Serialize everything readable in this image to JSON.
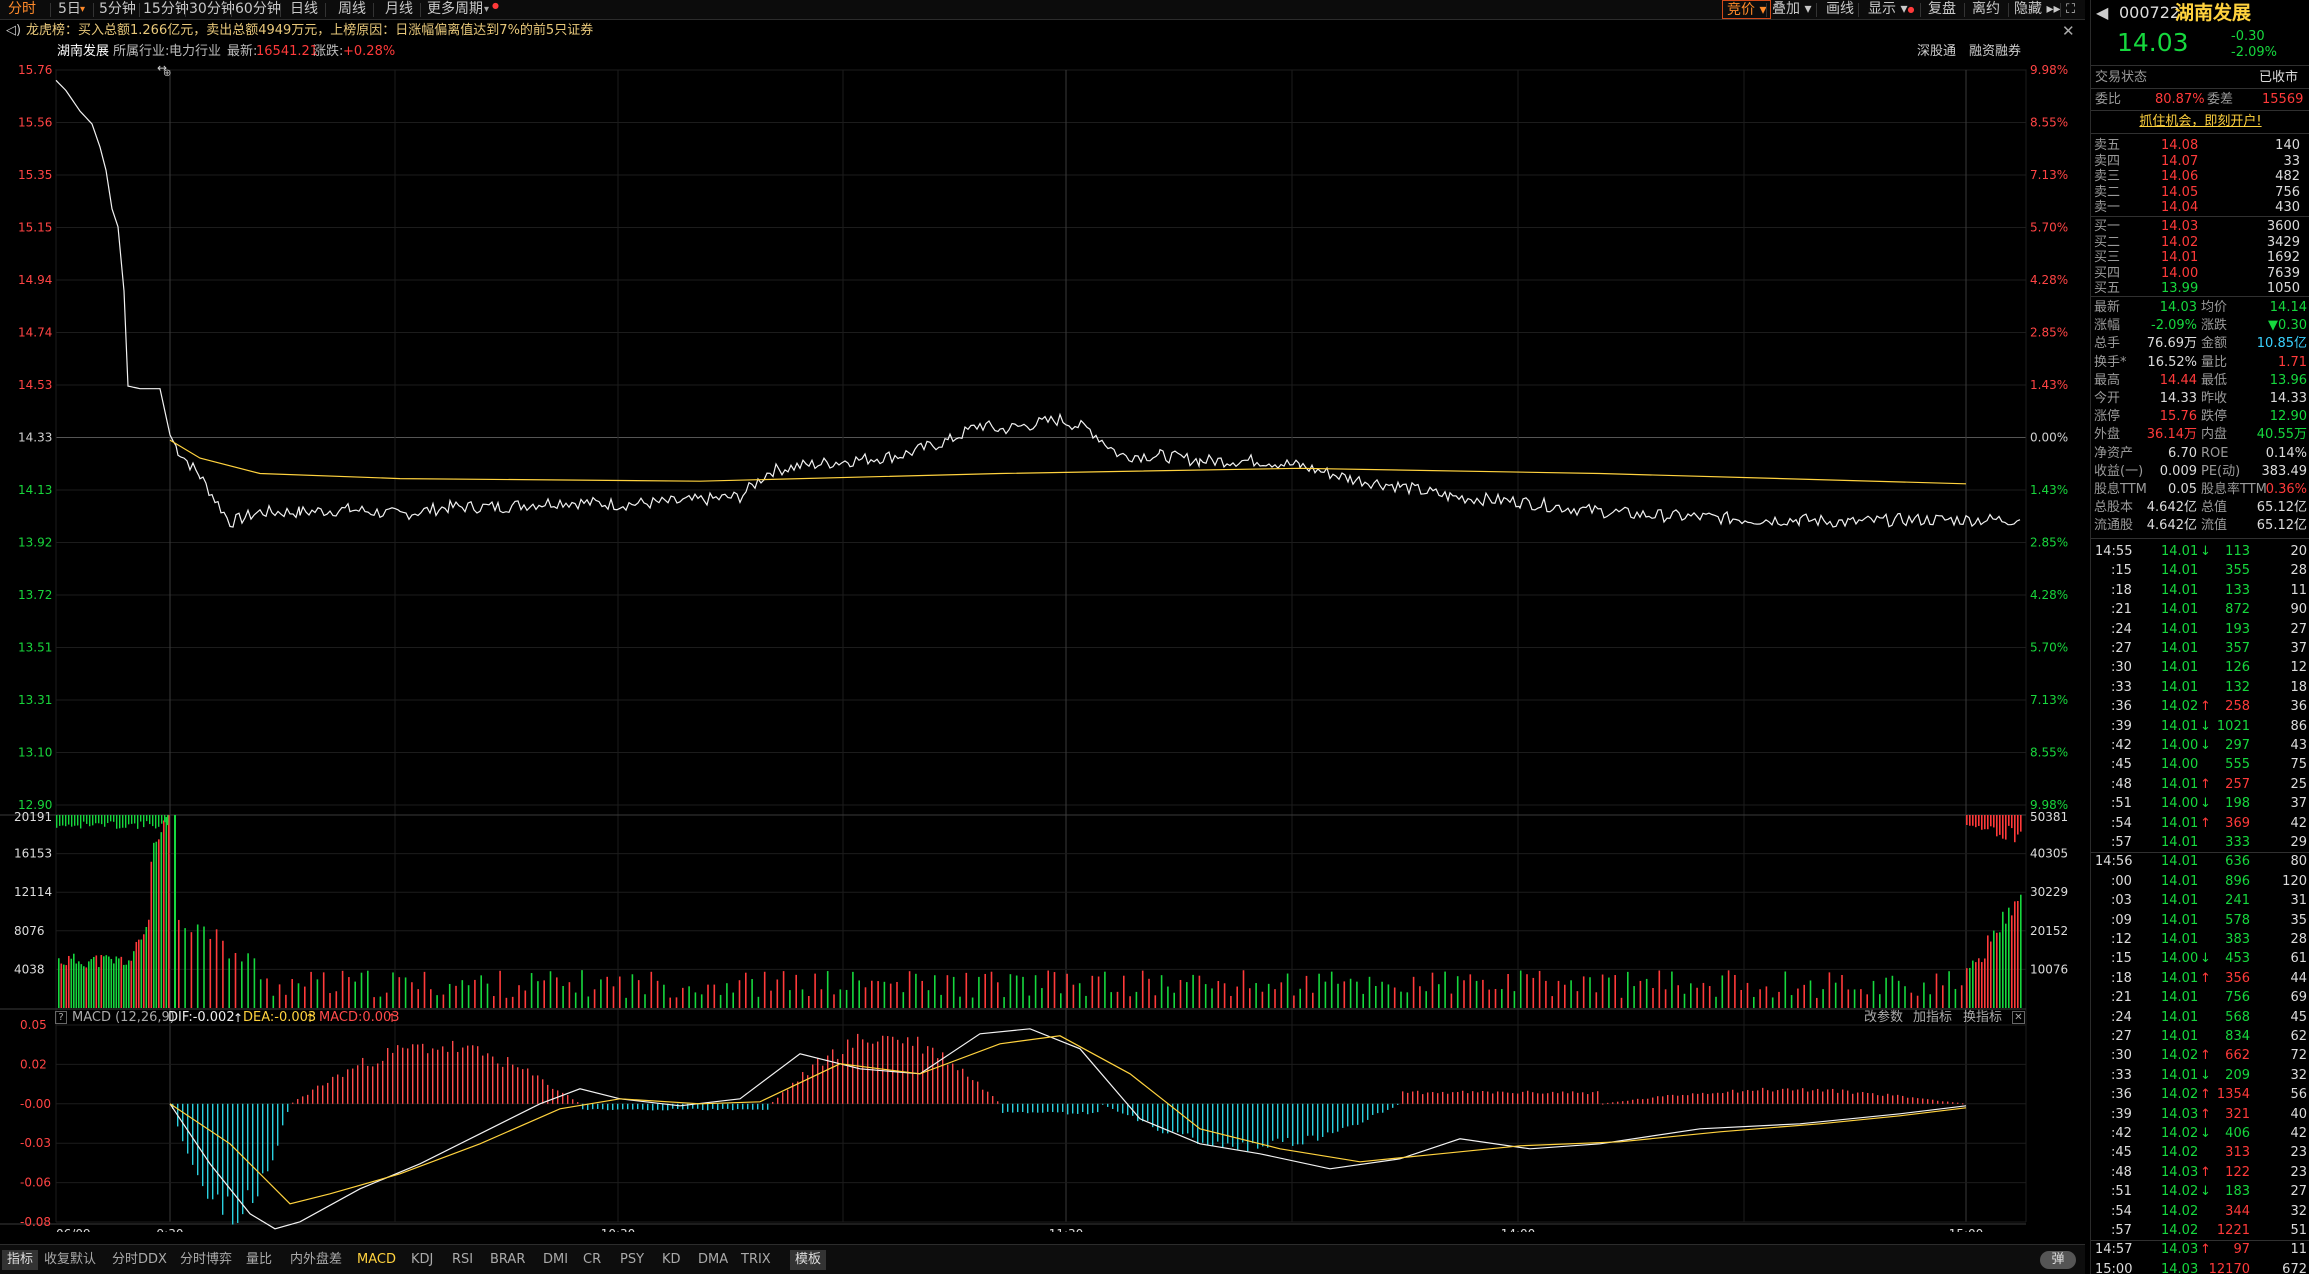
{
  "toolbar": {
    "tabs": [
      "分时",
      "5日",
      "5分钟",
      "15分钟",
      "30分钟",
      "60分钟",
      "日线",
      "周线",
      "月线",
      "更多周期"
    ],
    "right": [
      "竞价",
      "叠加",
      "画线",
      "显示",
      "复盘",
      "离约",
      "隐藏"
    ]
  },
  "info_bar": {
    "text": "龙虎榜：买入总额1.266亿元，卖出总额4949万元，上榜原因：日涨幅偏离值达到7%的前5只证券"
  },
  "stock_bar": {
    "name": "湖南发展",
    "industry_label": "所属行业:",
    "industry": "电力行业",
    "latest_label": "最新:",
    "latest": "16541.21",
    "change_label": "涨跌:",
    "change": "+0.28%",
    "links": [
      "深股通",
      "融资融券"
    ]
  },
  "price_chart": {
    "y_labels": [
      "15.76",
      "15.56",
      "15.35",
      "15.15",
      "14.94",
      "14.74",
      "14.53",
      "14.33",
      "14.13",
      "13.92",
      "13.72",
      "13.51",
      "13.31",
      "13.10",
      "12.90"
    ],
    "pct_labels": [
      "9.98%",
      "8.55%",
      "7.13%",
      "5.70%",
      "4.28%",
      "2.85%",
      "1.43%",
      "0.00%",
      "1.43%",
      "2.85%",
      "4.28%",
      "5.70%",
      "7.13%",
      "8.55%",
      "9.98%"
    ]
  },
  "volume_chart": {
    "left_labels": [
      "20191",
      "16153",
      "12114",
      "8076",
      "4038"
    ],
    "right_labels": [
      "50381",
      "40305",
      "30229",
      "20152",
      "10076"
    ]
  },
  "macd": {
    "header": "MACD (12,26,9)",
    "dif": "DIF:-0.002",
    "dea": "DEA:-0.003",
    "macd": "MACD:0.003",
    "buttons": [
      "改参数",
      "加指标",
      "换指标"
    ],
    "y_labels": [
      "0.05",
      "0.02",
      "-0.00",
      "-0.03",
      "-0.06",
      "-0.08"
    ]
  },
  "x_labels": [
    "06/09",
    "9:30",
    "10:30",
    "11:30",
    "14:00",
    "15:00"
  ],
  "bottom_tabs": [
    "指标",
    "收复默认",
    "分时DDX",
    "分时博弈",
    "量比",
    "内外盘差",
    "MACD",
    "KDJ",
    "RSI",
    "BRAR",
    "DMI",
    "CR",
    "PSY",
    "KD",
    "DMA",
    "TRIX",
    "模板"
  ],
  "bottom_right": "弹",
  "quote": {
    "code": "000722",
    "name": "湖南发展",
    "price": "14.03",
    "change": "-0.30",
    "change_pct": "-2.09%",
    "trade_status_label": "交易状态",
    "trade_status": "已收市",
    "weibi_label": "委比",
    "weibi": "80.87%",
    "weicha_label": "委差",
    "weicha": "15569",
    "promo": "抓住机会，即刻开户!",
    "sells": [
      {
        "label": "卖五",
        "price": "14.08",
        "vol": "140"
      },
      {
        "label": "卖四",
        "price": "14.07",
        "vol": "33"
      },
      {
        "label": "卖三",
        "price": "14.06",
        "vol": "482"
      },
      {
        "label": "卖二",
        "price": "14.05",
        "vol": "756"
      },
      {
        "label": "卖一",
        "price": "14.04",
        "vol": "430"
      }
    ],
    "buys": [
      {
        "label": "买一",
        "price": "14.03",
        "vol": "3600"
      },
      {
        "label": "买二",
        "price": "14.02",
        "vol": "3429"
      },
      {
        "label": "买三",
        "price": "14.01",
        "vol": "1692"
      },
      {
        "label": "买四",
        "price": "14.00",
        "vol": "7639"
      },
      {
        "label": "买五",
        "price": "13.99",
        "vol": "1050"
      }
    ],
    "stats": [
      [
        "最新",
        "14.03",
        "均价",
        "14.14"
      ],
      [
        "涨幅",
        "-2.09%",
        "涨跌",
        "▼0.30"
      ],
      [
        "总手",
        "76.69万",
        "金额",
        "10.85亿"
      ],
      [
        "换手*",
        "16.52%",
        "量比",
        "1.71"
      ],
      [
        "最高",
        "14.44",
        "最低",
        "13.96"
      ],
      [
        "今开",
        "14.33",
        "昨收",
        "14.33"
      ],
      [
        "涨停",
        "15.76",
        "跌停",
        "12.90"
      ],
      [
        "外盘",
        "36.14万",
        "内盘",
        "40.55万"
      ],
      [
        "净资产",
        "6.70",
        "ROE",
        "0.14%"
      ],
      [
        "收益(一)",
        "0.009",
        "PE(动)",
        "383.49"
      ],
      [
        "股息TTM",
        "0.05",
        "股息率TTM",
        "0.36%"
      ],
      [
        "总股本",
        "4.642亿",
        "总值",
        "65.12亿"
      ],
      [
        "流通股",
        "4.642亿",
        "流值",
        "65.12亿"
      ]
    ]
  },
  "ticks": [
    {
      "t": "14:55",
      "p": "14.01",
      "a": "↓",
      "v": "113",
      "n": "20"
    },
    {
      "t": ":15",
      "p": "14.01",
      "a": "",
      "v": "355",
      "n": "28"
    },
    {
      "t": ":18",
      "p": "14.01",
      "a": "",
      "v": "133",
      "n": "11"
    },
    {
      "t": ":21",
      "p": "14.01",
      "a": "",
      "v": "872",
      "n": "90"
    },
    {
      "t": ":24",
      "p": "14.01",
      "a": "",
      "v": "193",
      "n": "27"
    },
    {
      "t": ":27",
      "p": "14.01",
      "a": "",
      "v": "357",
      "n": "37"
    },
    {
      "t": ":30",
      "p": "14.01",
      "a": "",
      "v": "126",
      "n": "12"
    },
    {
      "t": ":33",
      "p": "14.01",
      "a": "",
      "v": "132",
      "n": "18"
    },
    {
      "t": ":36",
      "p": "14.02",
      "a": "↑",
      "v": "258",
      "n": "36"
    },
    {
      "t": ":39",
      "p": "14.01",
      "a": "↓",
      "v": "1021",
      "n": "86"
    },
    {
      "t": ":42",
      "p": "14.00",
      "a": "↓",
      "v": "297",
      "n": "43"
    },
    {
      "t": ":45",
      "p": "14.00",
      "a": "",
      "v": "555",
      "n": "75"
    },
    {
      "t": ":48",
      "p": "14.01",
      "a": "↑",
      "v": "257",
      "n": "25"
    },
    {
      "t": ":51",
      "p": "14.00",
      "a": "↓",
      "v": "198",
      "n": "37"
    },
    {
      "t": ":54",
      "p": "14.01",
      "a": "↑",
      "v": "369",
      "n": "42"
    },
    {
      "t": ":57",
      "p": "14.01",
      "a": "",
      "v": "333",
      "n": "29"
    },
    {
      "t": "14:56",
      "p": "14.01",
      "a": "",
      "v": "636",
      "n": "80"
    },
    {
      "t": ":00",
      "p": "14.01",
      "a": "",
      "v": "896",
      "n": "120"
    },
    {
      "t": ":03",
      "p": "14.01",
      "a": "",
      "v": "241",
      "n": "31"
    },
    {
      "t": ":09",
      "p": "14.01",
      "a": "",
      "v": "578",
      "n": "35"
    },
    {
      "t": ":12",
      "p": "14.01",
      "a": "",
      "v": "383",
      "n": "28"
    },
    {
      "t": ":15",
      "p": "14.00",
      "a": "↓",
      "v": "453",
      "n": "61"
    },
    {
      "t": ":18",
      "p": "14.01",
      "a": "↑",
      "v": "356",
      "n": "44"
    },
    {
      "t": ":21",
      "p": "14.01",
      "a": "",
      "v": "756",
      "n": "69"
    },
    {
      "t": ":24",
      "p": "14.01",
      "a": "",
      "v": "568",
      "n": "45"
    },
    {
      "t": ":27",
      "p": "14.01",
      "a": "",
      "v": "834",
      "n": "62"
    },
    {
      "t": ":30",
      "p": "14.02",
      "a": "↑",
      "v": "662",
      "n": "72"
    },
    {
      "t": ":33",
      "p": "14.01",
      "a": "↓",
      "v": "209",
      "n": "32"
    },
    {
      "t": ":36",
      "p": "14.02",
      "a": "↑",
      "v": "1354",
      "n": "56"
    },
    {
      "t": ":39",
      "p": "14.03",
      "a": "↑",
      "v": "321",
      "n": "40"
    },
    {
      "t": ":42",
      "p": "14.02",
      "a": "↓",
      "v": "406",
      "n": "42"
    },
    {
      "t": ":45",
      "p": "14.02",
      "a": "",
      "v": "313",
      "n": "23"
    },
    {
      "t": ":48",
      "p": "14.03",
      "a": "↑",
      "v": "122",
      "n": "23"
    },
    {
      "t": ":51",
      "p": "14.02",
      "a": "↓",
      "v": "183",
      "n": "27"
    },
    {
      "t": ":54",
      "p": "14.02",
      "a": "",
      "v": "344",
      "n": "32"
    },
    {
      "t": ":57",
      "p": "14.02",
      "a": "",
      "v": "1221",
      "n": "51"
    },
    {
      "t": "14:57",
      "p": "14.03",
      "a": "↑",
      "v": "97",
      "n": "11"
    },
    {
      "t": "15:00",
      "p": "14.03",
      "a": "",
      "v": "12170",
      "n": "672"
    }
  ]
}
